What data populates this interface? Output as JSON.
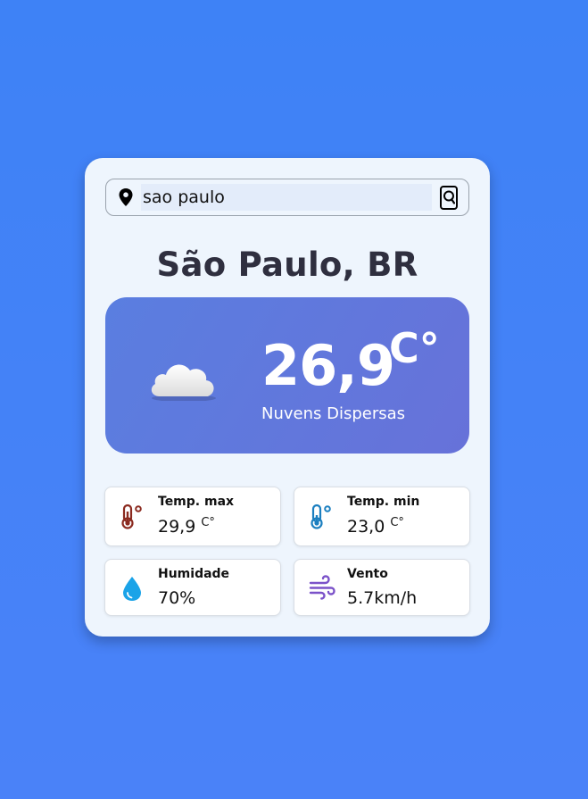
{
  "search": {
    "value": "sao paulo",
    "placeholder": ""
  },
  "location": {
    "title": "São Paulo, BR"
  },
  "current": {
    "temperature": "26,9",
    "unit": "C°",
    "description": "Nuvens Dispersas",
    "icon": "cloud-icon"
  },
  "stats": {
    "temp_max": {
      "label": "Temp. max",
      "value": "29,9",
      "unit": "C°",
      "icon": "thermometer-hot-icon",
      "color": "#8b2a1f"
    },
    "temp_min": {
      "label": "Temp. min",
      "value": "23,0",
      "unit": "C°",
      "icon": "thermometer-cold-icon",
      "color": "#1b7fc0"
    },
    "humidity": {
      "label": "Humidade",
      "value": "70%",
      "icon": "water-drop-icon",
      "color": "#1aa3e8"
    },
    "wind": {
      "label": "Vento",
      "value": "5.7km/h",
      "icon": "wind-icon",
      "color": "#7b52c9"
    }
  },
  "colors": {
    "background": "#3e82f6",
    "card": "#eef5fd",
    "accent": "#5f78dd"
  }
}
